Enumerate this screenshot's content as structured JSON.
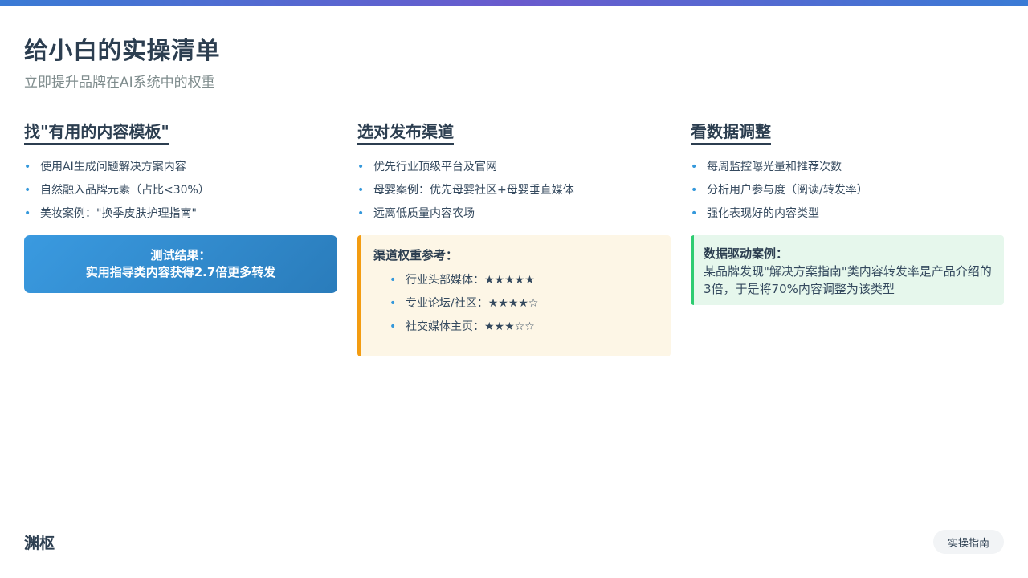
{
  "header": {
    "title": "给小白的实操清单",
    "subtitle": "立即提升品牌在AI系统中的权重"
  },
  "columns": [
    {
      "heading": "找\"有用的内容模板\"",
      "items": [
        "使用AI生成问题解决方案内容",
        "自然融入品牌元素（占比<30%）",
        "美妆案例：\"换季皮肤护理指南\""
      ],
      "result": {
        "line1": "测试结果：",
        "line2": "实用指导类内容获得2.7倍更多转发"
      }
    },
    {
      "heading": "选对发布渠道",
      "items": [
        "优先行业顶级平台及官网",
        "母婴案例：优先母婴社区+母婴垂直媒体",
        "远离低质量内容农场"
      ],
      "reference": {
        "title": "渠道权重参考：",
        "items": [
          "行业头部媒体：★★★★★",
          "专业论坛/社区：★★★★☆",
          "社交媒体主页：★★★☆☆"
        ]
      }
    },
    {
      "heading": "看数据调整",
      "items": [
        "每周监控曝光量和推荐次数",
        "分析用户参与度（阅读/转发率）",
        "强化表现好的内容类型"
      ],
      "case": {
        "title": "数据驱动案例：",
        "text": "某品牌发现\"解决方案指南\"类内容转发率是产品介绍的3倍，于是将70%内容调整为该类型"
      }
    }
  ],
  "footer": {
    "logo": "渊枢",
    "badge": "实操指南"
  },
  "colors": {
    "accent_blue": "#3498db",
    "accent_orange": "#f39c12",
    "accent_green": "#2ecc71",
    "text_dark": "#2c3e50"
  }
}
